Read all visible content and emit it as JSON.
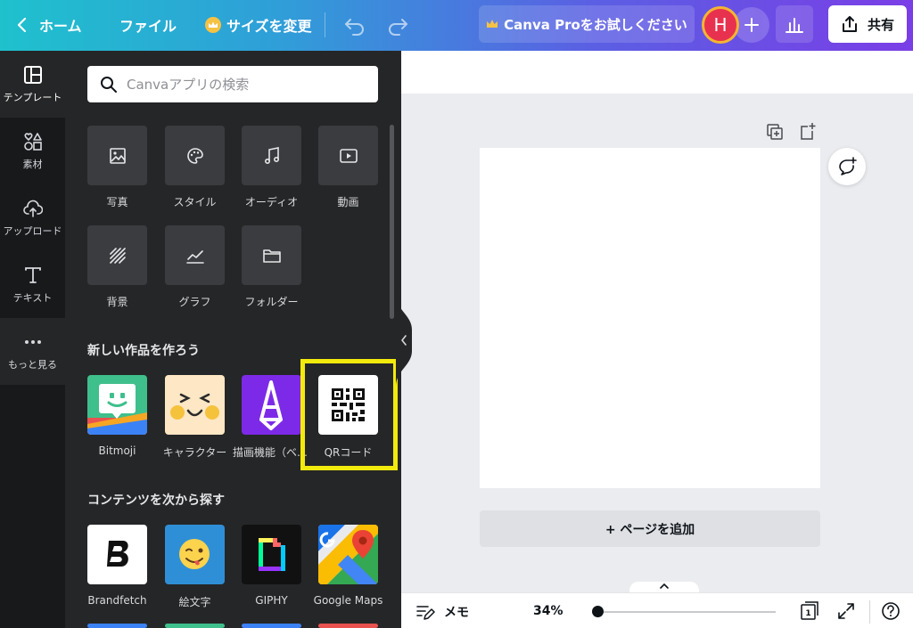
{
  "header": {
    "back_label": "ホーム",
    "file_label": "ファイル",
    "resize_label": "サイズを変更",
    "try_pro_label": "Canva Proをお試しください",
    "avatar_initial": "H",
    "share_label": "共有"
  },
  "rail": {
    "items": [
      {
        "label": "テンプレート",
        "icon": "template-icon"
      },
      {
        "label": "素材",
        "icon": "elements-icon"
      },
      {
        "label": "アップロード",
        "icon": "upload-icon"
      },
      {
        "label": "テキスト",
        "icon": "text-icon"
      },
      {
        "label": "もっと見る",
        "icon": "more-icon"
      }
    ]
  },
  "panel": {
    "search_placeholder": "Canvaアプリの検索",
    "tools": [
      {
        "label": "写真",
        "icon": "photo-icon"
      },
      {
        "label": "スタイル",
        "icon": "palette-icon"
      },
      {
        "label": "オーディオ",
        "icon": "music-icon"
      },
      {
        "label": "動画",
        "icon": "video-icon"
      },
      {
        "label": "背景",
        "icon": "background-icon"
      },
      {
        "label": "グラフ",
        "icon": "chart-icon"
      },
      {
        "label": "フォルダー",
        "icon": "folder-icon"
      }
    ],
    "create_title": "新しい作品を作ろう",
    "create_apps": [
      {
        "label": "Bitmoji"
      },
      {
        "label": "キャラクター"
      },
      {
        "label": "描画機能（ベータ版）"
      },
      {
        "label": "QRコード"
      }
    ],
    "discover_title": "コンテンツを次から探す",
    "discover_apps": [
      {
        "label": "Brandfetch"
      },
      {
        "label": "絵文字"
      },
      {
        "label": "GIPHY"
      },
      {
        "label": "Google Maps"
      }
    ]
  },
  "canvas": {
    "add_page_label": "+ ページを追加"
  },
  "footer": {
    "memo_label": "メモ",
    "zoom": "34%",
    "page_count": "1"
  }
}
